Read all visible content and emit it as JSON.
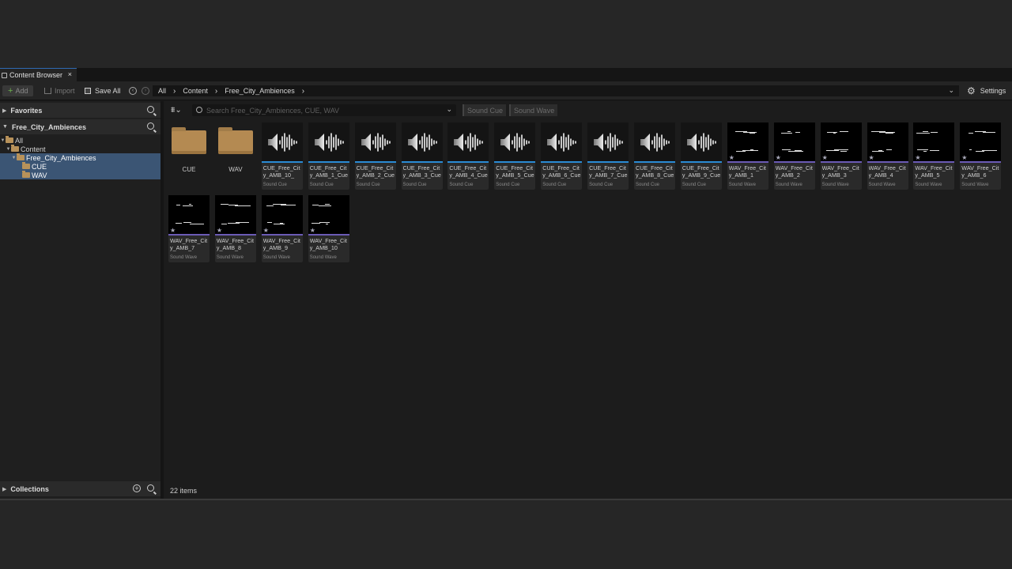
{
  "tab": {
    "title": "Content Browser",
    "close": "×"
  },
  "toolbar": {
    "add_label": "Add",
    "import_label": "Import",
    "save_all_label": "Save All",
    "settings_label": "Settings"
  },
  "breadcrumb": [
    "All",
    "Content",
    "Free_City_Ambiences"
  ],
  "left": {
    "favorites": "Favorites",
    "root_section": "Free_City_Ambiences",
    "collections": "Collections",
    "tree": [
      {
        "label": "All",
        "indent": 0
      },
      {
        "label": "Content",
        "indent": 1
      },
      {
        "label": "Free_City_Ambiences",
        "indent": 2,
        "selected": true
      },
      {
        "label": "CUE",
        "indent": 3,
        "selected": true
      },
      {
        "label": "WAV",
        "indent": 3,
        "selected": true
      }
    ]
  },
  "search": {
    "placeholder": "Search Free_City_Ambiences, CUE, WAV"
  },
  "filters": {
    "cue": "Sound Cue",
    "wave": "Sound Wave"
  },
  "assets": [
    {
      "kind": "folder",
      "name": "CUE"
    },
    {
      "kind": "folder",
      "name": "WAV"
    },
    {
      "kind": "cue",
      "name": "CUE_Free_City_AMB_10_",
      "type": "Sound Cue"
    },
    {
      "kind": "cue",
      "name": "CUE_Free_City_AMB_1_Cue",
      "type": "Sound Cue"
    },
    {
      "kind": "cue",
      "name": "CUE_Free_City_AMB_2_Cue",
      "type": "Sound Cue"
    },
    {
      "kind": "cue",
      "name": "CUE_Free_City_AMB_3_Cue",
      "type": "Sound Cue"
    },
    {
      "kind": "cue",
      "name": "CUE_Free_City_AMB_4_Cue",
      "type": "Sound Cue"
    },
    {
      "kind": "cue",
      "name": "CUE_Free_City_AMB_5_Cue",
      "type": "Sound Cue"
    },
    {
      "kind": "cue",
      "name": "CUE_Free_City_AMB_6_Cue",
      "type": "Sound Cue"
    },
    {
      "kind": "cue",
      "name": "CUE_Free_City_AMB_7_Cue",
      "type": "Sound Cue"
    },
    {
      "kind": "cue",
      "name": "CUE_Free_City_AMB_8_Cue",
      "type": "Sound Cue"
    },
    {
      "kind": "cue",
      "name": "CUE_Free_City_AMB_9_Cue",
      "type": "Sound Cue"
    },
    {
      "kind": "wave",
      "name": "WAV_Free_City_AMB_1",
      "type": "Sound Wave"
    },
    {
      "kind": "wave",
      "name": "WAV_Free_City_AMB_2",
      "type": "Sound Wave"
    },
    {
      "kind": "wave",
      "name": "WAV_Free_City_AMB_3",
      "type": "Sound Wave"
    },
    {
      "kind": "wave",
      "name": "WAV_Free_City_AMB_4",
      "type": "Sound Wave"
    },
    {
      "kind": "wave",
      "name": "WAV_Free_City_AMB_5",
      "type": "Sound Wave"
    },
    {
      "kind": "wave",
      "name": "WAV_Free_City_AMB_6",
      "type": "Sound Wave"
    },
    {
      "kind": "wave",
      "name": "WAV_Free_City_AMB_7",
      "type": "Sound Wave"
    },
    {
      "kind": "wave",
      "name": "WAV_Free_City_AMB_8",
      "type": "Sound Wave"
    },
    {
      "kind": "wave",
      "name": "WAV_Free_City_AMB_9",
      "type": "Sound Wave"
    },
    {
      "kind": "wave",
      "name": "WAV_Free_City_AMB_10",
      "type": "Sound Wave"
    }
  ],
  "status": "22 items",
  "colors": {
    "accent_cue": "#2a8bd4",
    "accent_wave": "#6b5bb5",
    "selection": "#3b5574",
    "folder": "#b48a52"
  }
}
